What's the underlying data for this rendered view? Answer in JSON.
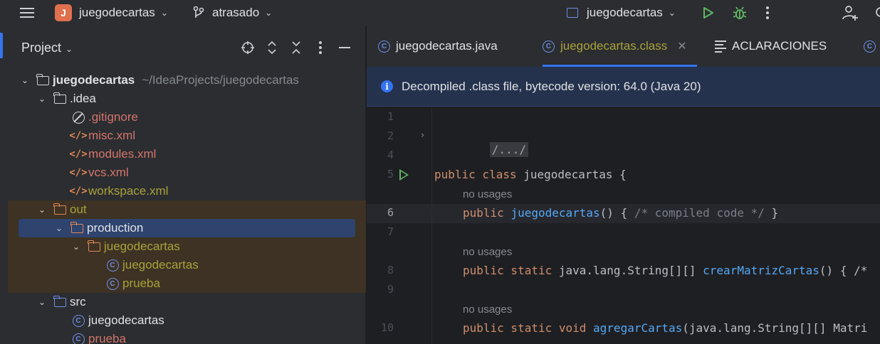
{
  "titlebar": {
    "project_initial": "J",
    "project_name": "juegodecartas",
    "branch": "atrasado",
    "run_config": "juegodecartas"
  },
  "project_panel": {
    "title": "Project",
    "tree": [
      {
        "label": "juegodecartas",
        "path": "~/IdeaProjects/juegodecartas",
        "icon": "folder",
        "color": "white"
      },
      {
        "label": ".idea",
        "icon": "folder",
        "color": "white"
      },
      {
        "label": ".gitignore",
        "icon": "ignore-file",
        "color": "red"
      },
      {
        "label": "misc.xml",
        "icon": "xml-file",
        "color": "red"
      },
      {
        "label": "modules.xml",
        "icon": "xml-file",
        "color": "red"
      },
      {
        "label": "vcs.xml",
        "icon": "xml-file",
        "color": "red"
      },
      {
        "label": "workspace.xml",
        "icon": "xml-file",
        "color": "olive"
      },
      {
        "label": "out",
        "icon": "folder",
        "color": "olive"
      },
      {
        "label": "production",
        "icon": "folder",
        "color": "white"
      },
      {
        "label": "juegodecartas",
        "icon": "folder",
        "color": "olive"
      },
      {
        "label": "juegodecartas",
        "icon": "class",
        "color": "olive"
      },
      {
        "label": "prueba",
        "icon": "class",
        "color": "olive"
      },
      {
        "label": "src",
        "icon": "folder",
        "color": "white"
      },
      {
        "label": "juegodecartas",
        "icon": "class",
        "color": "white"
      },
      {
        "label": "prueba",
        "icon": "class",
        "color": "red"
      }
    ]
  },
  "tabs": [
    {
      "label": "juegodecartas.java"
    },
    {
      "label": "juegodecartas.class",
      "active": true
    },
    {
      "label": "ACLARACIONES"
    }
  ],
  "banner": {
    "text": "Decompiled .class file, bytecode version: 64.0 (Java 20)"
  },
  "code": {
    "line_numbers": [
      "1",
      "2",
      "4",
      "5",
      "6",
      "7",
      "8",
      "9",
      "10"
    ],
    "fold_text": "/.../",
    "hint": "no usages",
    "l5": {
      "kw": "public class",
      "name": "juegodecartas",
      "rest": " {"
    },
    "l6": {
      "kw": "public",
      "fn": "juegodecartas",
      "mid": "() { ",
      "cmt": "/* compiled code */",
      "end": " }"
    },
    "l8": {
      "kw": "public static",
      "type": " java.lang.String[][] ",
      "fn": "crearMatrizCartas",
      "rest": "() { /*"
    },
    "l10": {
      "kw": "public static void",
      "fn": "agregarCartas",
      "rest": "(java.lang.String[][] Matri"
    }
  },
  "colors": {
    "accent": "#3574f0",
    "run_green": "#5fb865",
    "vcs_red": "#d5756c",
    "vcs_olive": "#a9a23b",
    "keyword": "#cf8e6d",
    "function": "#56a8f5"
  }
}
